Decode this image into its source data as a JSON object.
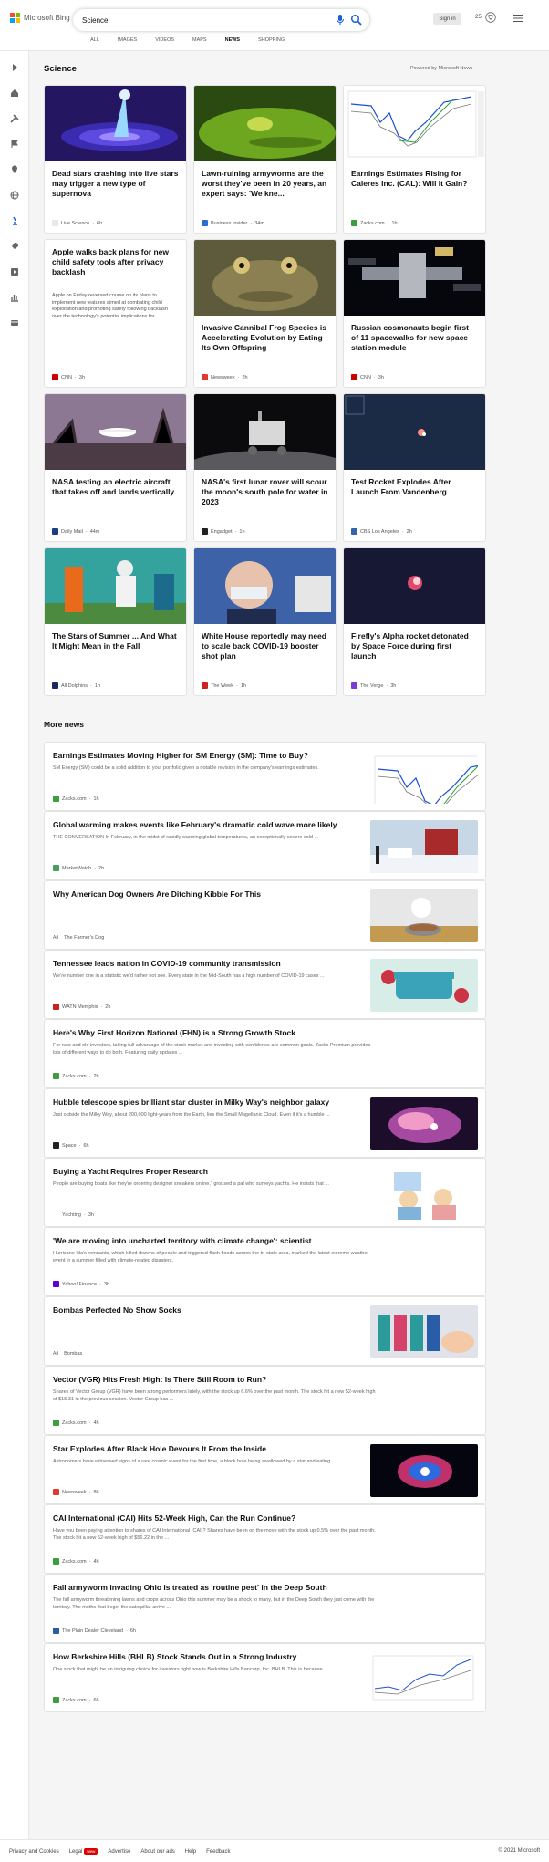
{
  "brand": {
    "logo_text": "Microsoft Bing",
    "colors": [
      "#f25022",
      "#7fba00",
      "#00a4ef",
      "#ffb900"
    ]
  },
  "search": {
    "value": "Science"
  },
  "header": {
    "signin_label": "Sign in",
    "points": "25"
  },
  "tabs": [
    {
      "label": "ALL",
      "active": false
    },
    {
      "label": "IMAGES",
      "active": false
    },
    {
      "label": "VIDEOS",
      "active": false
    },
    {
      "label": "MAPS",
      "active": false
    },
    {
      "label": "NEWS",
      "active": true
    },
    {
      "label": "SHOPPING",
      "active": false
    }
  ],
  "sidebar_icons": [
    "expand-icon",
    "home-icon",
    "tools-icon",
    "flag-icon",
    "pin-icon",
    "globe-icon",
    "microscope-icon",
    "rocket-icon",
    "video-icon",
    "chart-icon",
    "money-icon"
  ],
  "section": {
    "title": "Science",
    "powered": "Powered by Microsoft News"
  },
  "cards": [
    {
      "title": "Dead stars crashing into live stars may trigger a new type of supernova",
      "snippet": "",
      "source": "Live Science",
      "time": "6h",
      "source_color": "#e8e8e8",
      "image": "supernova"
    },
    {
      "title": "Lawn-ruining armyworms are the worst they've been in 20 years, an expert says: 'We kne...",
      "snippet": "",
      "source": "Business Insider",
      "time": "34m",
      "source_color": "#2a6ed3",
      "image": "armyworm"
    },
    {
      "title": "Earnings Estimates Rising for Caleres Inc. (CAL): Will It Gain?",
      "snippet": "",
      "source": "Zacks.com",
      "time": "1h",
      "source_color": "#3c9e3c",
      "image": "stockchart"
    },
    {
      "title": "Apple walks back plans for new child safety tools after privacy backlash",
      "snippet": "Apple on Friday reversed course on its plans to implement new features aimed at combating child exploitation and promoting safety following backlash over the technology's potential implications for ...",
      "source": "CNN",
      "time": "3h",
      "source_color": "#cc0000",
      "image": "none"
    },
    {
      "title": "Invasive Cannibal Frog Species is Accelerating Evolution by Eating Its Own Offspring",
      "snippet": "",
      "source": "Newsweek",
      "time": "2h",
      "source_color": "#e03a2f",
      "image": "toad"
    },
    {
      "title": "Russian cosmonauts begin first of 11 spacewalks for new space station module",
      "snippet": "",
      "source": "CNN",
      "time": "3h",
      "source_color": "#cc0000",
      "image": "station"
    },
    {
      "title": "NASA testing an electric aircraft that takes off and lands vertically",
      "snippet": "",
      "source": "Daily Mail",
      "time": "44m",
      "source_color": "#1a3e8a",
      "image": "aircraft"
    },
    {
      "title": "NASA's first lunar rover will scour the moon's south pole for water in 2023",
      "snippet": "",
      "source": "Engadget",
      "time": "1h",
      "source_color": "#222222",
      "image": "rover"
    },
    {
      "title": "Test Rocket Explodes After Launch From Vandenberg",
      "snippet": "",
      "source": "CBS Los Angeles",
      "time": "2h",
      "source_color": "#3366aa",
      "image": "nightsky"
    },
    {
      "title": "The Stars of Summer ... And What It Might Mean in the Fall",
      "snippet": "",
      "source": "All Dolphins",
      "time": "1h",
      "source_color": "#1a2a5a",
      "image": "football"
    },
    {
      "title": "White House reportedly may need to scale back COVID-19 booster shot plan",
      "snippet": "",
      "source": "The Week",
      "time": "1h",
      "source_color": "#cc2222",
      "image": "vaccine"
    },
    {
      "title": "Firefly's Alpha rocket detonated by Space Force during first launch",
      "snippet": "",
      "source": "The Verge",
      "time": "3h",
      "source_color": "#7a3bd6",
      "image": "explosion"
    }
  ],
  "more_news": {
    "title": "More news",
    "items": [
      {
        "title": "Earnings Estimates Moving Higher for SM Energy (SM): Time to Buy?",
        "snippet": "SM Energy (SM) could be a solid addition to your portfolio given a notable revision in the company's earnings estimates.",
        "source": "Zacks.com",
        "time": "1h",
        "ad": "",
        "source_color": "#3c9e3c",
        "thumb": "stockchart"
      },
      {
        "title": "Global warming makes events like February's dramatic cold wave more likely",
        "snippet": "THE CONVERSATION In February, in the midst of rapidly warming global temperatures, an exceptionally severe cold ...",
        "source": "MarketWatch",
        "time": "2h",
        "ad": "",
        "source_color": "#4a9e5c",
        "thumb": "snow"
      },
      {
        "title": "Why American Dog Owners Are Ditching Kibble For This",
        "snippet": "",
        "source": "The Farmer's Dog",
        "time": "",
        "ad": "Ad",
        "source_color": "",
        "thumb": "dog"
      },
      {
        "title": "Tennessee leads nation in COVID-19 community transmission",
        "snippet": "We're number one in a statistic we'd rather not see. Every state in the Mid-South has a high number of COVID-19 cases ...",
        "source": "WATN Memphis",
        "time": "2h",
        "ad": "",
        "source_color": "#cc2222",
        "thumb": "tennessee"
      },
      {
        "title": "Here's Why First Horizon National (FHN) is a Strong Growth Stock",
        "snippet": "For new and old investors, taking full advantage of the stock market and investing with confidence are common goals. Zacks Premium provides lots of different ways to do both. Featuring daily updates ...",
        "source": "Zacks.com",
        "time": "2h",
        "ad": "",
        "source_color": "#3c9e3c",
        "thumb": "none"
      },
      {
        "title": "Hubble telescope spies brilliant star cluster in Milky Way's neighbor galaxy",
        "snippet": "Just outside the Milky Way, about 200,000 light-years from the Earth, lies the Small Magellanic Cloud. Even if it's a humble ...",
        "source": "Space",
        "time": "6h",
        "ad": "",
        "source_color": "#222222",
        "thumb": "nebula"
      },
      {
        "title": "Buying a Yacht Requires Proper Research",
        "snippet": "People are buying boats like they're ordering designer sneakers online,\" groused a pal who surveys yachts. He insists that ...",
        "source": "Yachting",
        "time": "3h",
        "ad": "",
        "source_color": "#ffffff",
        "thumb": "cartoon"
      },
      {
        "title": "'We are moving into uncharted territory with climate change': scientist",
        "snippet": "Hurricane Ida's remnants, which killed dozens of people and triggered flash floods across the tri-state area, marked the latest extreme weather event in a summer filled with climate-related disasters.",
        "source": "Yahoo! Finance",
        "time": "3h",
        "ad": "",
        "source_color": "#6001d2",
        "thumb": "none"
      },
      {
        "title": "Bombas Perfected No Show Socks",
        "snippet": "",
        "source": "Bombas",
        "time": "",
        "ad": "Ad",
        "source_color": "",
        "thumb": "socks"
      },
      {
        "title": "Vector (VGR) Hits Fresh High: Is There Still Room to Run?",
        "snippet": "Shares of Vector Group (VGR) have been strong performers lately, with the stock up 6.6% over the past month. The stock hit a new 52-week high of $15.31 in the previous session. Vector Group has ...",
        "source": "Zacks.com",
        "time": "4h",
        "ad": "",
        "source_color": "#3c9e3c",
        "thumb": "none"
      },
      {
        "title": "Star Explodes After Black Hole Devours It From the Inside",
        "snippet": "Astronomers have witnessed signs of a rare cosmic event for the first time, a black hole being swallowed by a star and eating ...",
        "source": "Newsweek",
        "time": "8h",
        "ad": "",
        "source_color": "#e03a2f",
        "thumb": "blackhole"
      },
      {
        "title": "CAI International (CAI) Hits 52-Week High, Can the Run Continue?",
        "snippet": "Have you been paying attention to shares of CAI International (CAI)? Shares have been on the move with the stock up 0.5% over the past month. The stock hit a new 52-week high of $56.22 in the ...",
        "source": "Zacks.com",
        "time": "4h",
        "ad": "",
        "source_color": "#3c9e3c",
        "thumb": "none"
      },
      {
        "title": "Fall armyworm invading Ohio is treated as 'routine pest' in the Deep South",
        "snippet": "The fall armyworm threatening lawns and crops across Ohio this summer may be a shock to many, but in the Deep South they just come with the territory. The moths that beget the caterpillar arrive ...",
        "source": "The Plain Dealer Cleveland",
        "time": "6h",
        "ad": "",
        "source_color": "#2a5ca8",
        "thumb": "none"
      },
      {
        "title": "How Berkshire Hills (BHLB) Stock Stands Out in a Strong Industry",
        "snippet": "One stock that might be an intriguing choice for investors right now is Berkshire Hills Bancorp, Inc. BHLB. This is because ...",
        "source": "Zacks.com",
        "time": "6h",
        "ad": "",
        "source_color": "#3c9e3c",
        "thumb": "stockchart2"
      }
    ]
  },
  "footer": {
    "links": [
      "Privacy and Cookies",
      "Legal",
      "Advertise",
      "About our ads",
      "Help",
      "Feedback"
    ],
    "new_badge": "New",
    "copyright": "© 2021 Microsoft"
  }
}
